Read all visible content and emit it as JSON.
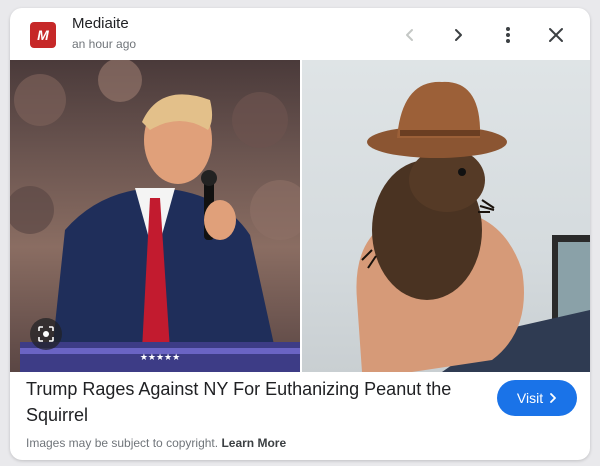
{
  "header": {
    "logo_letter": "M",
    "source_name": "Mediaite",
    "time": "an hour ago",
    "icons": {
      "prev": "chevron-left-icon",
      "next": "chevron-right-icon",
      "more": "more-vert-icon",
      "close": "close-icon",
      "lens": "lens-icon"
    }
  },
  "article": {
    "title": "Trump Rages Against NY For Euthanizing Peanut the Squirrel",
    "visit_label": "Visit",
    "copyright_text": "Images may be subject to copyright.",
    "learn_more": "Learn More"
  },
  "colors": {
    "logo": "#c62828",
    "visit_button": "#1a73e8"
  }
}
